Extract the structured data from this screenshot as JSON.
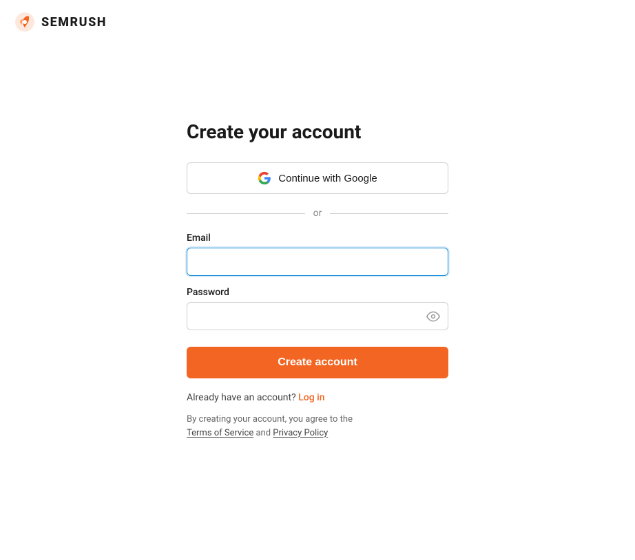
{
  "logo": {
    "text": "SEMRUSH"
  },
  "form": {
    "title": "Create your account",
    "google_btn": "Continue with Google",
    "divider_text": "or",
    "email_label": "Email",
    "email_placeholder": "",
    "password_label": "Password",
    "password_placeholder": "",
    "create_btn": "Create account",
    "login_prompt": "Already have an account?",
    "login_link": "Log in",
    "terms_prefix": "By creating your account, you agree to the",
    "terms_link": "Terms of Service",
    "terms_conjunction": "and",
    "privacy_link": "Privacy Policy"
  },
  "colors": {
    "accent": "#f26522",
    "google_border": "#d0d0d0",
    "focus_border": "#1a8cd8"
  }
}
